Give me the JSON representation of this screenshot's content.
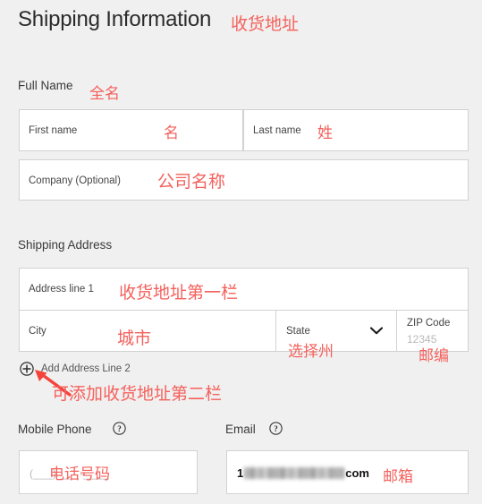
{
  "page": {
    "title": "Shipping Information",
    "title_annotation": "收货地址",
    "background_color": "#f0f0f0",
    "annotation_color": "#f4615c"
  },
  "full_name": {
    "label": "Full Name",
    "annotation": "全名",
    "first_name": {
      "label": "First name",
      "annotation": "名",
      "value": ""
    },
    "last_name": {
      "label": "Last name",
      "annotation": "姓",
      "value": ""
    },
    "company": {
      "label": "Company (Optional)",
      "annotation": "公司名称",
      "value": ""
    }
  },
  "shipping_address": {
    "label": "Shipping Address",
    "address_line_1": {
      "label": "Address line 1",
      "annotation": "收货地址第一栏",
      "value": ""
    },
    "city": {
      "label": "City",
      "annotation": "城市",
      "value": ""
    },
    "state": {
      "label": "State",
      "annotation": "选择州",
      "value": "",
      "icon": "chevron-down-icon"
    },
    "zip": {
      "label": "ZIP Code",
      "placeholder": "12345",
      "annotation": "邮编",
      "value": ""
    },
    "add_address_line_2": {
      "label": "Add Address Line 2",
      "icon": "circle-plus-icon",
      "annotation": "可添加收货地址第二栏"
    }
  },
  "contact": {
    "mobile_phone": {
      "label": "Mobile Phone",
      "help_icon": "question-circle-icon",
      "placeholder": "(___) ___-____",
      "annotation": "电话号码",
      "value": ""
    },
    "email": {
      "label": "Email",
      "help_icon": "question-circle-icon",
      "annotation": "邮箱",
      "value_prefix": "1",
      "value_redacted": true,
      "value_suffix": "com"
    }
  }
}
